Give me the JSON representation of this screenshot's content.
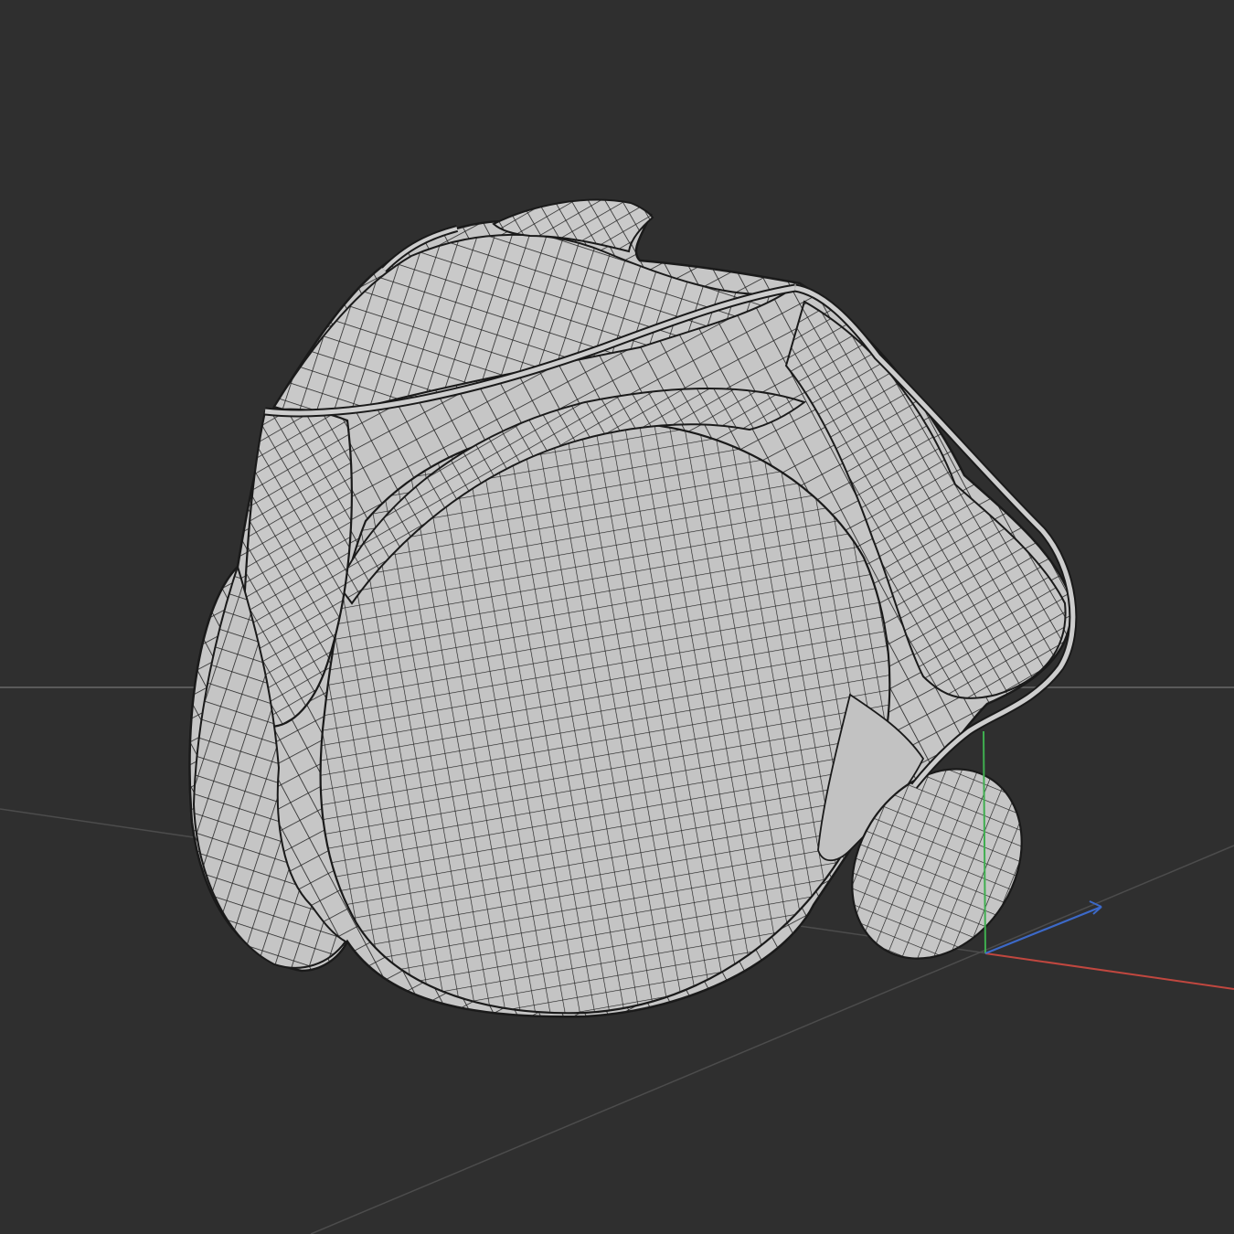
{
  "viewport": {
    "background_color": "#2f2f2f",
    "display_mode": "wireframe-on-shaded",
    "model": {
      "name": "",
      "surface_color": "#c6c6c6",
      "wire_color": "#1e1e1e",
      "shading": "flat-gray"
    },
    "grid": {
      "visible": true,
      "line_color": "#555555"
    },
    "gizmo": {
      "visible": true,
      "axes": [
        {
          "axis": "x",
          "color": "#c0473f"
        },
        {
          "axis": "y",
          "color": "#3fae4f"
        },
        {
          "axis": "z",
          "color": "#3c69c8"
        }
      ]
    }
  }
}
